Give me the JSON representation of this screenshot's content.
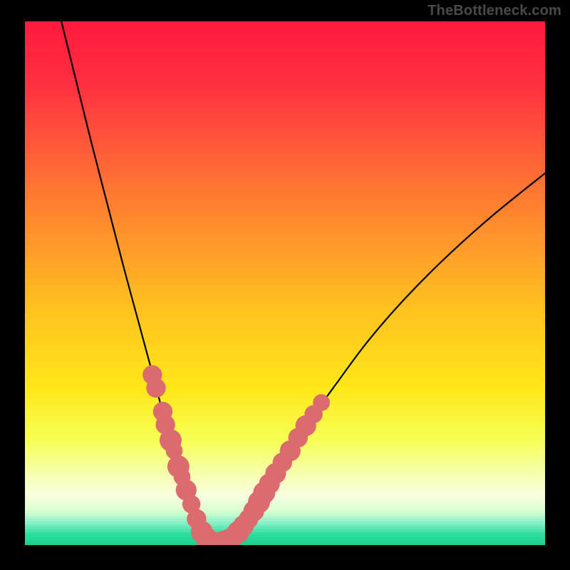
{
  "watermark": "TheBottleneck.com",
  "gradient_stops": [
    {
      "pos": 0.0,
      "color": "#ff1a3f"
    },
    {
      "pos": 0.12,
      "color": "#ff3040"
    },
    {
      "pos": 0.24,
      "color": "#ff5a38"
    },
    {
      "pos": 0.38,
      "color": "#ff8a2e"
    },
    {
      "pos": 0.55,
      "color": "#ffc21f"
    },
    {
      "pos": 0.7,
      "color": "#ffe81a"
    },
    {
      "pos": 0.8,
      "color": "#f6ff55"
    },
    {
      "pos": 0.86,
      "color": "#f5ffa8"
    },
    {
      "pos": 0.905,
      "color": "#f8ffe0"
    },
    {
      "pos": 0.935,
      "color": "#d8ffd0"
    },
    {
      "pos": 0.958,
      "color": "#86f0c8"
    },
    {
      "pos": 0.978,
      "color": "#30dfa2"
    },
    {
      "pos": 1.0,
      "color": "#17d18f"
    }
  ],
  "dot_color": "#db6b6d",
  "chart_data": {
    "type": "line",
    "title": "",
    "xlabel": "",
    "ylabel": "",
    "xlim": [
      0,
      100
    ],
    "ylim": [
      0,
      100
    ],
    "series_curve": {
      "name": "bottleneck-curve",
      "comment": "V-shaped curve; minimum near x≈35, y≈0. Left branch steep from top-left; right branch rises toward upper-right.",
      "x": [
        7,
        10,
        13,
        16,
        19,
        22,
        25,
        27,
        29,
        31,
        33,
        35,
        37,
        40,
        43,
        46,
        50,
        55,
        60,
        66,
        73,
        81,
        90,
        100
      ],
      "y": [
        100,
        88,
        76,
        64.5,
        53,
        42,
        31,
        23.5,
        17.5,
        11.5,
        6,
        1.5,
        0.5,
        1.5,
        5,
        10,
        16,
        24,
        31,
        39,
        47,
        55,
        63,
        71
      ]
    },
    "series_dots": {
      "name": "highlight-points",
      "comment": "Salmon dots clustered near the bottom of both branches and along the trough.",
      "points": [
        {
          "x": 24.5,
          "y": 32.5,
          "r": 1.5
        },
        {
          "x": 25.2,
          "y": 30.0,
          "r": 1.5
        },
        {
          "x": 26.5,
          "y": 25.5,
          "r": 1.5
        },
        {
          "x": 27.0,
          "y": 23.0,
          "r": 1.5
        },
        {
          "x": 28.0,
          "y": 20.0,
          "r": 1.7
        },
        {
          "x": 28.7,
          "y": 18.0,
          "r": 1.3
        },
        {
          "x": 29.5,
          "y": 15.0,
          "r": 1.7
        },
        {
          "x": 30.2,
          "y": 13.0,
          "r": 1.3
        },
        {
          "x": 31.0,
          "y": 10.5,
          "r": 1.6
        },
        {
          "x": 32.0,
          "y": 7.8,
          "r": 1.4
        },
        {
          "x": 33.0,
          "y": 5.0,
          "r": 1.5
        },
        {
          "x": 34.0,
          "y": 2.5,
          "r": 1.7
        },
        {
          "x": 35.0,
          "y": 1.2,
          "r": 1.7
        },
        {
          "x": 36.0,
          "y": 0.6,
          "r": 1.6
        },
        {
          "x": 37.0,
          "y": 0.5,
          "r": 1.6
        },
        {
          "x": 38.0,
          "y": 0.7,
          "r": 1.6
        },
        {
          "x": 39.0,
          "y": 1.0,
          "r": 1.6
        },
        {
          "x": 40.0,
          "y": 1.5,
          "r": 1.6
        },
        {
          "x": 41.0,
          "y": 2.5,
          "r": 1.7
        },
        {
          "x": 42.0,
          "y": 3.7,
          "r": 1.6
        },
        {
          "x": 43.0,
          "y": 5.0,
          "r": 1.5
        },
        {
          "x": 44.0,
          "y": 6.5,
          "r": 1.6
        },
        {
          "x": 45.0,
          "y": 8.2,
          "r": 1.7
        },
        {
          "x": 46.0,
          "y": 10.0,
          "r": 1.7
        },
        {
          "x": 47.0,
          "y": 11.7,
          "r": 1.6
        },
        {
          "x": 48.2,
          "y": 13.7,
          "r": 1.6
        },
        {
          "x": 49.5,
          "y": 15.8,
          "r": 1.5
        },
        {
          "x": 51.0,
          "y": 18.0,
          "r": 1.6
        },
        {
          "x": 52.5,
          "y": 20.5,
          "r": 1.5
        },
        {
          "x": 54.0,
          "y": 22.8,
          "r": 1.6
        },
        {
          "x": 55.5,
          "y": 25.0,
          "r": 1.4
        },
        {
          "x": 57.0,
          "y": 27.2,
          "r": 1.3
        }
      ]
    }
  }
}
